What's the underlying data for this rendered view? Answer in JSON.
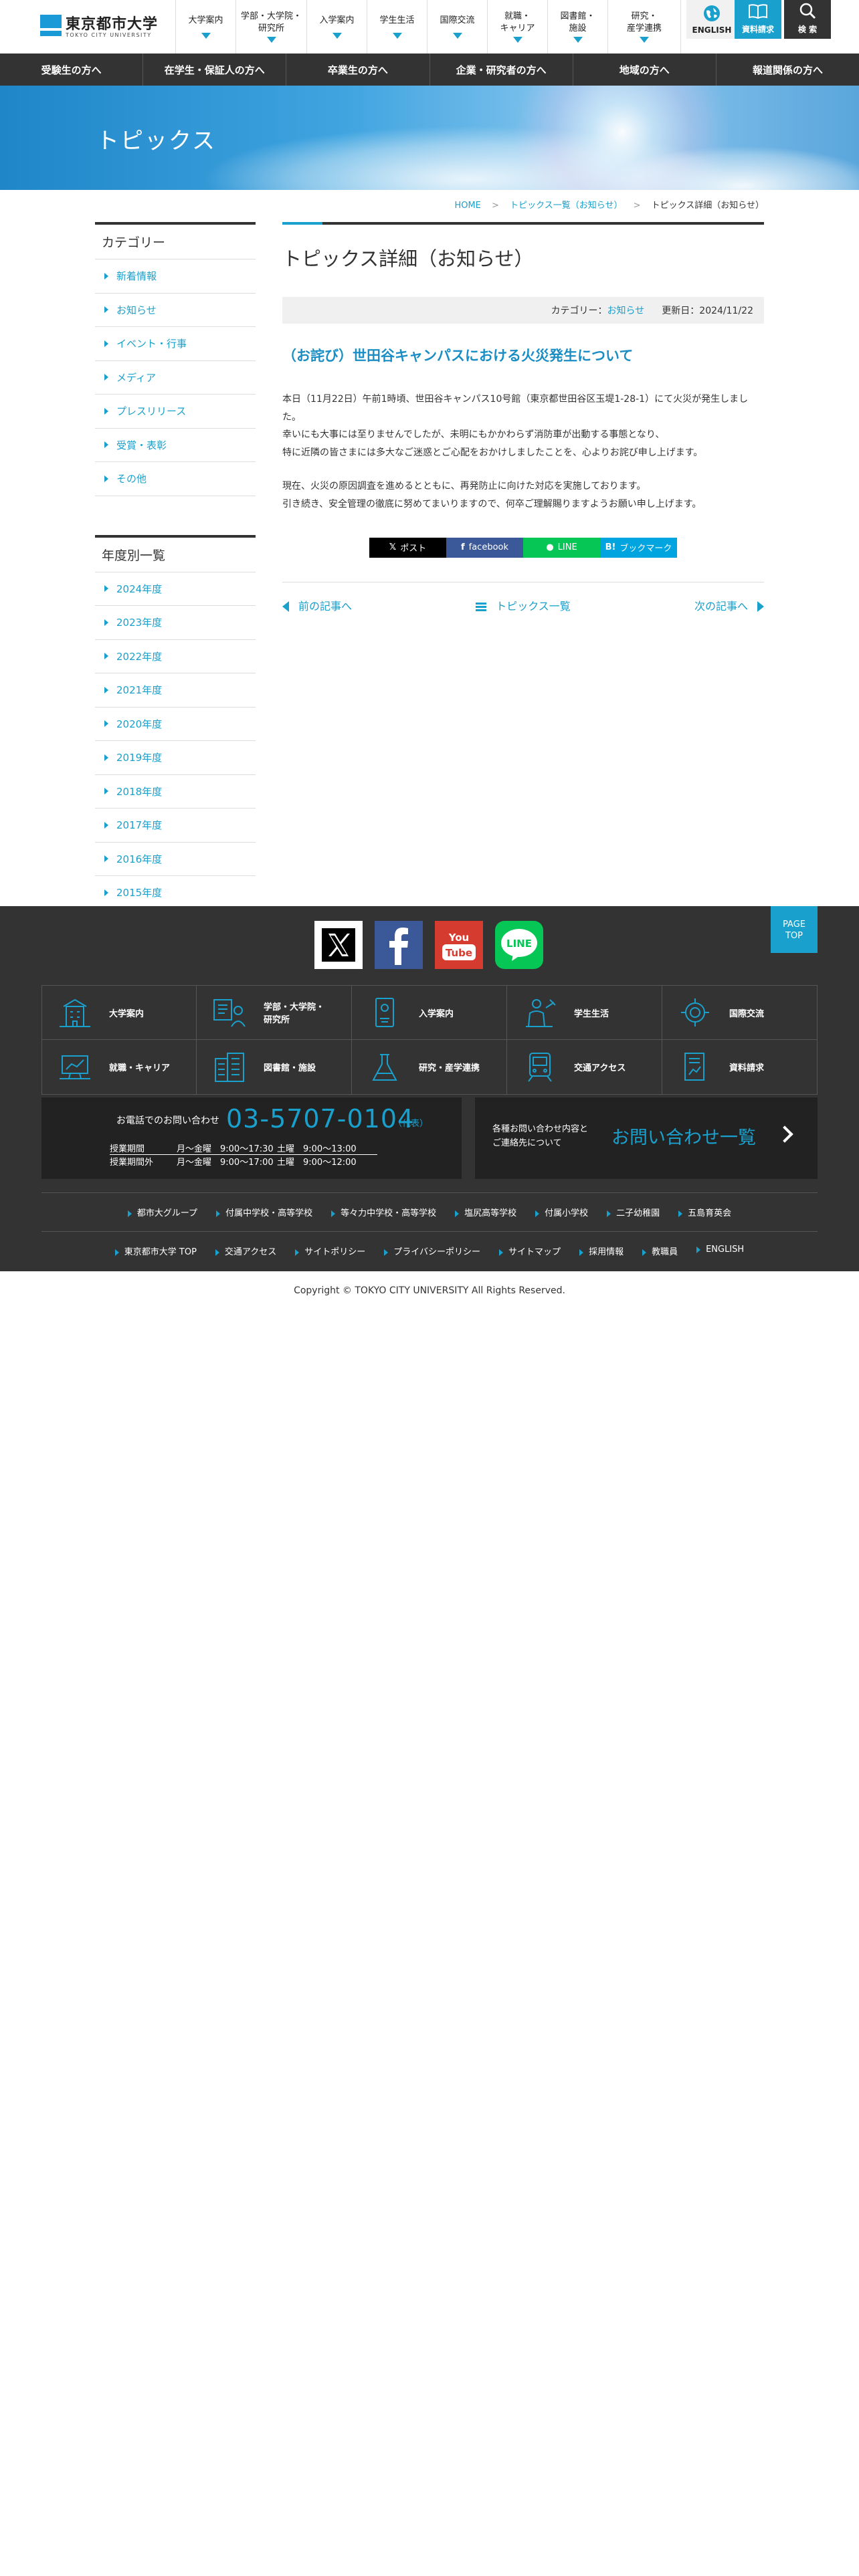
{
  "header": {
    "logo_name": "東京都市大学",
    "logo_sub": "TOKYO CITY UNIVERSITY",
    "nav": [
      {
        "l1": "大学案内",
        "l2": ""
      },
      {
        "l1": "学部・大学院・",
        "l2": "研究所"
      },
      {
        "l1": "入学案内",
        "l2": ""
      },
      {
        "l1": "学生生活",
        "l2": ""
      },
      {
        "l1": "国際交流",
        "l2": ""
      },
      {
        "l1": "就職・",
        "l2": "キャリア"
      },
      {
        "l1": "図書館・",
        "l2": "施設"
      },
      {
        "l1": "研究・",
        "l2": "産学連携"
      }
    ],
    "english_label": "ENGLISH",
    "request_label": "資料請求",
    "search_label": "検 索"
  },
  "category_bar": [
    "受験生の方へ",
    "在学生・保証人の方へ",
    "卒業生の方へ",
    "企業・研究者の方へ",
    "地域の方へ",
    "報道関係の方へ"
  ],
  "hero": {
    "title": "トピックス"
  },
  "breadcrumb": {
    "home": "HOME",
    "list": "トピックス一覧（お知らせ）",
    "current": "トピックス詳細（お知らせ）"
  },
  "sidebar": {
    "category_title": "カテゴリー",
    "categories": [
      "新着情報",
      "お知らせ",
      "イベント・行事",
      "メディア",
      "プレスリリース",
      "受賞・表彰",
      "その他"
    ],
    "year_title": "年度別一覧",
    "years": [
      "2024年度",
      "2023年度",
      "2022年度",
      "2021年度",
      "2020年度",
      "2019年度",
      "2018年度",
      "2017年度",
      "2016年度",
      "2015年度"
    ]
  },
  "main": {
    "page_title": "トピックス詳細（お知らせ）",
    "category_label": "カテゴリー：",
    "category_value": "お知らせ",
    "updated": "更新日：2024/11/22",
    "article_title": "（お詫び）世田谷キャンパスにおける火災発生について",
    "para1": [
      "本日（11月22日）午前1時頃、世田谷キャンパス10号館（東京都世田谷区玉堤1-28-1）にて火災が発生しました。",
      "幸いにも大事には至りませんでしたが、未明にもかかわらず消防車が出動する事態となり、",
      "特に近隣の皆さまには多大なご迷惑とご心配をおかけしましたことを、心よりお詫び申し上げます。"
    ],
    "para2": [
      "現在、火災の原因調査を進めるとともに、再発防止に向けた対応を実施しております。",
      "引き続き、安全管理の徹底に努めてまいりますので、何卒ご理解賜りますようお願い申し上げます。"
    ],
    "share": {
      "x": "ポスト",
      "facebook": "facebook",
      "line": "LINE",
      "hatena": "ブックマーク"
    },
    "pager": {
      "prev": "前の記事へ",
      "list": "トピックス一覧",
      "next": "次の記事へ"
    }
  },
  "footer": {
    "pagetop": [
      "PAGE",
      "TOP"
    ],
    "links_grid": [
      {
        "icon": "building-icon",
        "label": "大学案内"
      },
      {
        "icon": "faculty-icon",
        "label": "学部・大学院・\n研究所"
      },
      {
        "icon": "admission-icon",
        "label": "入学案内"
      },
      {
        "icon": "student-life-icon",
        "label": "学生生活"
      },
      {
        "icon": "globe-icon",
        "label": "国際交流"
      },
      {
        "icon": "career-icon",
        "label": "就職・キャリア"
      },
      {
        "icon": "library-icon",
        "label": "図書館・施設"
      },
      {
        "icon": "flask-icon",
        "label": "研究・産学連携"
      },
      {
        "icon": "train-icon",
        "label": "交通アクセス"
      },
      {
        "icon": "document-icon",
        "label": "資料請求"
      }
    ],
    "tel_label": "お電話でのお問い合わせ",
    "tel_number": "03-5707-0104",
    "tel_rep": "（代表）",
    "hours": [
      {
        "label": "授業期間",
        "weekday": "月～金曜　9:00～17:30",
        "sat": "土曜　9:00～13:00"
      },
      {
        "label": "授業期間外",
        "weekday": "月～金曜　9:00～17:00",
        "sat": "土曜　9:00～12:00"
      }
    ],
    "form_desc": [
      "各種お問い合わせ内容と",
      "ご連絡先について"
    ],
    "form_title": "お問い合わせ一覧",
    "group_links": [
      "都市大グループ",
      "付属中学校・高等学校",
      "等々力中学校・高等学校",
      "塩尻高等学校",
      "付属小学校",
      "二子幼稚園",
      "五島育英会"
    ],
    "site_links": [
      "東京都市大学 TOP",
      "交通アクセス",
      "サイトポリシー",
      "プライバシーポリシー",
      "サイトマップ",
      "採用情報",
      "教職員",
      "ENGLISH"
    ]
  },
  "copyright": "Copyright © TOKYO CITY UNIVERSITY All Rights Reserved.",
  "colors": {
    "accent": "#1aa0cc",
    "dark": "#333333",
    "footer_panel": "#222222"
  }
}
